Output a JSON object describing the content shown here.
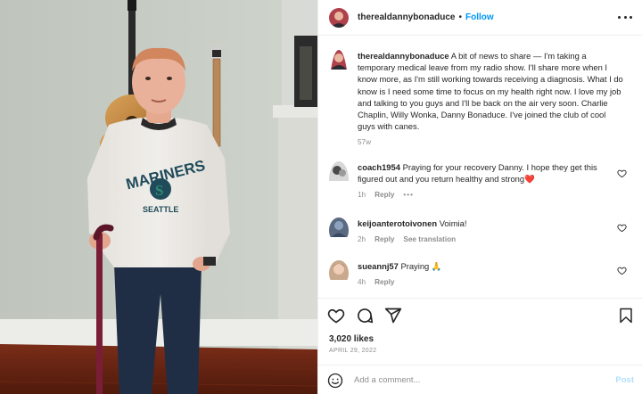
{
  "post": {
    "username": "therealdannybonaduce",
    "follow_label": "Follow",
    "dot": "•",
    "caption": "A bit of news to share — I'm taking a temporary medical leave from my radio show. I'll share more when I know more, as I'm still working towards receiving a diagnosis. What I do know is I need some time to focus on my health right now. I love my job and talking to you guys and I'll be back on the air very soon. Charlie Chaplin, Willy Wonka, Danny Bonaduce. I've joined the club of cool guys with canes.",
    "caption_time": "57w",
    "likes": "3,020 likes",
    "date": "APRIL 29, 2022"
  },
  "photo": {
    "shirt_text_top": "MARINERS",
    "shirt_letter": "S",
    "shirt_text_bottom": "SEATTLE"
  },
  "comments": [
    {
      "username": "coach1954",
      "text": "Praying for your recovery Danny. I hope they get this figured out and you return healthy and strong",
      "emoji": "❤️",
      "time": "1h",
      "reply_label": "Reply",
      "more": "•••"
    },
    {
      "username": "keijoanterotoivonen",
      "text": "Voimia!",
      "time": "2h",
      "reply_label": "Reply",
      "translation_label": "See translation"
    },
    {
      "username": "sueannj57",
      "text": "Praying",
      "emoji": "🙏",
      "time": "4h",
      "reply_label": "Reply"
    }
  ],
  "add_comment": {
    "placeholder": "Add a comment...",
    "post_label": "Post"
  },
  "colors": {
    "follow_blue": "#0095f6",
    "post_disabled": "#b2dffc",
    "muted": "#8e8e8e",
    "text": "#262626"
  },
  "icons": [
    "more-icon",
    "heart-icon",
    "comment-icon",
    "share-icon",
    "bookmark-icon",
    "emoji-icon"
  ]
}
